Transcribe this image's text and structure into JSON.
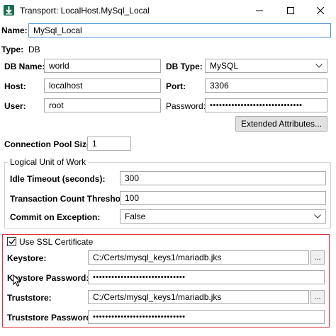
{
  "window": {
    "title": "Transport: LocalHost.MySql_Local",
    "app_icon": "download-arrow-icon",
    "controls": [
      "minimize-icon",
      "maximize-icon",
      "close-icon"
    ]
  },
  "name": {
    "label": "Name:",
    "value": "MySql_Local"
  },
  "type": {
    "label": "Type:",
    "value": "DB"
  },
  "db_name": {
    "label": "DB Name:",
    "value": "world"
  },
  "db_type": {
    "label": "DB Type:",
    "value": "MySQL"
  },
  "host": {
    "label": "Host:",
    "value": "localhost"
  },
  "port": {
    "label": "Port:",
    "value": "3306"
  },
  "user": {
    "label": "User:",
    "value": "root"
  },
  "password": {
    "label": "Password:",
    "value": "••••••••••••••••••••••••••••••"
  },
  "extended_attributes": {
    "label": "Extended Attributes..."
  },
  "pool_size": {
    "label": "Connection Pool Size:",
    "value": "1"
  },
  "luw": {
    "legend": "Logical Unit of Work",
    "idle_timeout": {
      "label": "Idle Timeout (seconds):",
      "value": "300"
    },
    "txn_threshold": {
      "label": "Transaction Count Threshold:",
      "value": "100"
    },
    "commit_on_exception": {
      "label": "Commit on Exception:",
      "value": "False"
    }
  },
  "ssl": {
    "checkbox_label": "Use SSL Certificate",
    "checked": true,
    "keystore": {
      "label": "Keystore:",
      "value": "C:/Certs/mysql_keys1/mariadb.jks",
      "browse": "..."
    },
    "keystore_password": {
      "label": "Keystore Password:",
      "value": "••••••••••••••••••••••••••••••"
    },
    "truststore": {
      "label": "Truststore:",
      "value": "C:/Certs/mysql_keys1/mariadb.jks",
      "browse": "..."
    },
    "truststore_password": {
      "label": "Truststore Password:",
      "value": "••••••••••••••••••••••••••••••"
    }
  },
  "colors": {
    "focus_border": "#4a8fd6",
    "highlight_border": "#e0303a",
    "app_icon_bg": "#1a6b4f"
  }
}
